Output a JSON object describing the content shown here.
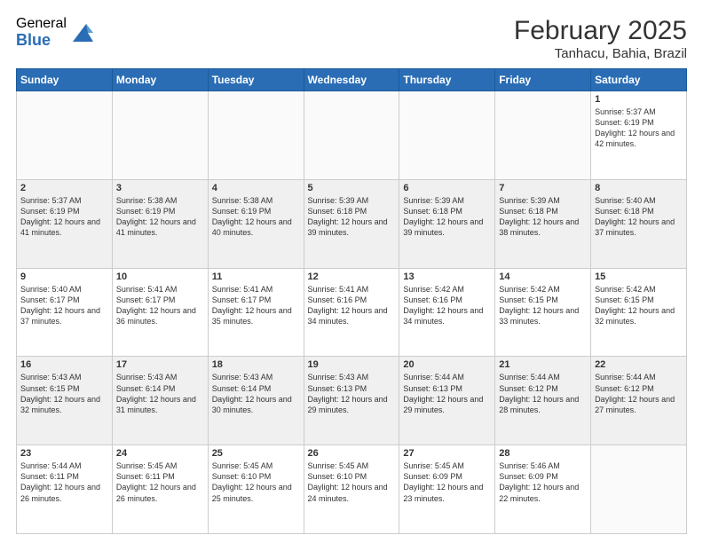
{
  "logo": {
    "general": "General",
    "blue": "Blue"
  },
  "title": {
    "month_year": "February 2025",
    "location": "Tanhacu, Bahia, Brazil"
  },
  "weekdays": [
    "Sunday",
    "Monday",
    "Tuesday",
    "Wednesday",
    "Thursday",
    "Friday",
    "Saturday"
  ],
  "weeks": [
    [
      {
        "day": "",
        "info": ""
      },
      {
        "day": "",
        "info": ""
      },
      {
        "day": "",
        "info": ""
      },
      {
        "day": "",
        "info": ""
      },
      {
        "day": "",
        "info": ""
      },
      {
        "day": "",
        "info": ""
      },
      {
        "day": "1",
        "info": "Sunrise: 5:37 AM\nSunset: 6:19 PM\nDaylight: 12 hours and 42 minutes."
      }
    ],
    [
      {
        "day": "2",
        "info": "Sunrise: 5:37 AM\nSunset: 6:19 PM\nDaylight: 12 hours and 41 minutes."
      },
      {
        "day": "3",
        "info": "Sunrise: 5:38 AM\nSunset: 6:19 PM\nDaylight: 12 hours and 41 minutes."
      },
      {
        "day": "4",
        "info": "Sunrise: 5:38 AM\nSunset: 6:19 PM\nDaylight: 12 hours and 40 minutes."
      },
      {
        "day": "5",
        "info": "Sunrise: 5:39 AM\nSunset: 6:18 PM\nDaylight: 12 hours and 39 minutes."
      },
      {
        "day": "6",
        "info": "Sunrise: 5:39 AM\nSunset: 6:18 PM\nDaylight: 12 hours and 39 minutes."
      },
      {
        "day": "7",
        "info": "Sunrise: 5:39 AM\nSunset: 6:18 PM\nDaylight: 12 hours and 38 minutes."
      },
      {
        "day": "8",
        "info": "Sunrise: 5:40 AM\nSunset: 6:18 PM\nDaylight: 12 hours and 37 minutes."
      }
    ],
    [
      {
        "day": "9",
        "info": "Sunrise: 5:40 AM\nSunset: 6:17 PM\nDaylight: 12 hours and 37 minutes."
      },
      {
        "day": "10",
        "info": "Sunrise: 5:41 AM\nSunset: 6:17 PM\nDaylight: 12 hours and 36 minutes."
      },
      {
        "day": "11",
        "info": "Sunrise: 5:41 AM\nSunset: 6:17 PM\nDaylight: 12 hours and 35 minutes."
      },
      {
        "day": "12",
        "info": "Sunrise: 5:41 AM\nSunset: 6:16 PM\nDaylight: 12 hours and 34 minutes."
      },
      {
        "day": "13",
        "info": "Sunrise: 5:42 AM\nSunset: 6:16 PM\nDaylight: 12 hours and 34 minutes."
      },
      {
        "day": "14",
        "info": "Sunrise: 5:42 AM\nSunset: 6:15 PM\nDaylight: 12 hours and 33 minutes."
      },
      {
        "day": "15",
        "info": "Sunrise: 5:42 AM\nSunset: 6:15 PM\nDaylight: 12 hours and 32 minutes."
      }
    ],
    [
      {
        "day": "16",
        "info": "Sunrise: 5:43 AM\nSunset: 6:15 PM\nDaylight: 12 hours and 32 minutes."
      },
      {
        "day": "17",
        "info": "Sunrise: 5:43 AM\nSunset: 6:14 PM\nDaylight: 12 hours and 31 minutes."
      },
      {
        "day": "18",
        "info": "Sunrise: 5:43 AM\nSunset: 6:14 PM\nDaylight: 12 hours and 30 minutes."
      },
      {
        "day": "19",
        "info": "Sunrise: 5:43 AM\nSunset: 6:13 PM\nDaylight: 12 hours and 29 minutes."
      },
      {
        "day": "20",
        "info": "Sunrise: 5:44 AM\nSunset: 6:13 PM\nDaylight: 12 hours and 29 minutes."
      },
      {
        "day": "21",
        "info": "Sunrise: 5:44 AM\nSunset: 6:12 PM\nDaylight: 12 hours and 28 minutes."
      },
      {
        "day": "22",
        "info": "Sunrise: 5:44 AM\nSunset: 6:12 PM\nDaylight: 12 hours and 27 minutes."
      }
    ],
    [
      {
        "day": "23",
        "info": "Sunrise: 5:44 AM\nSunset: 6:11 PM\nDaylight: 12 hours and 26 minutes."
      },
      {
        "day": "24",
        "info": "Sunrise: 5:45 AM\nSunset: 6:11 PM\nDaylight: 12 hours and 26 minutes."
      },
      {
        "day": "25",
        "info": "Sunrise: 5:45 AM\nSunset: 6:10 PM\nDaylight: 12 hours and 25 minutes."
      },
      {
        "day": "26",
        "info": "Sunrise: 5:45 AM\nSunset: 6:10 PM\nDaylight: 12 hours and 24 minutes."
      },
      {
        "day": "27",
        "info": "Sunrise: 5:45 AM\nSunset: 6:09 PM\nDaylight: 12 hours and 23 minutes."
      },
      {
        "day": "28",
        "info": "Sunrise: 5:46 AM\nSunset: 6:09 PM\nDaylight: 12 hours and 22 minutes."
      },
      {
        "day": "",
        "info": ""
      }
    ]
  ]
}
